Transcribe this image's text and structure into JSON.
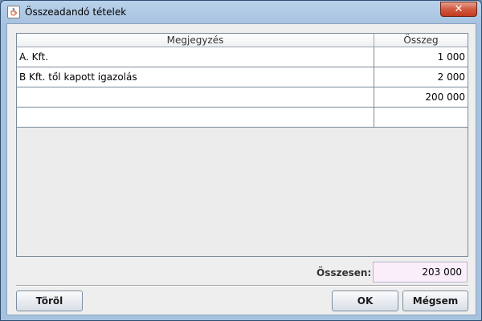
{
  "window": {
    "title": "Összeadandó tételek",
    "close_symbol": "✕",
    "app_icon": "java-cup-icon"
  },
  "table": {
    "columns": [
      "Megjegyzés",
      "Összeg"
    ],
    "rows": [
      {
        "note": "A. Kft.",
        "amount": "1 000"
      },
      {
        "note": "B Kft. től kapott igazolás",
        "amount": "2 000"
      },
      {
        "note": "",
        "amount": "200 000"
      },
      {
        "note": "",
        "amount": ""
      }
    ]
  },
  "total": {
    "label": "Összesen:",
    "value": "203 000"
  },
  "buttons": {
    "delete_label": "Töröl",
    "ok_label": "OK",
    "cancel_label": "Mégsem"
  },
  "colors": {
    "total_field_bg": "#fbeefb",
    "close_button": "#c13a1f",
    "titlebar": "#b9d1ea"
  }
}
